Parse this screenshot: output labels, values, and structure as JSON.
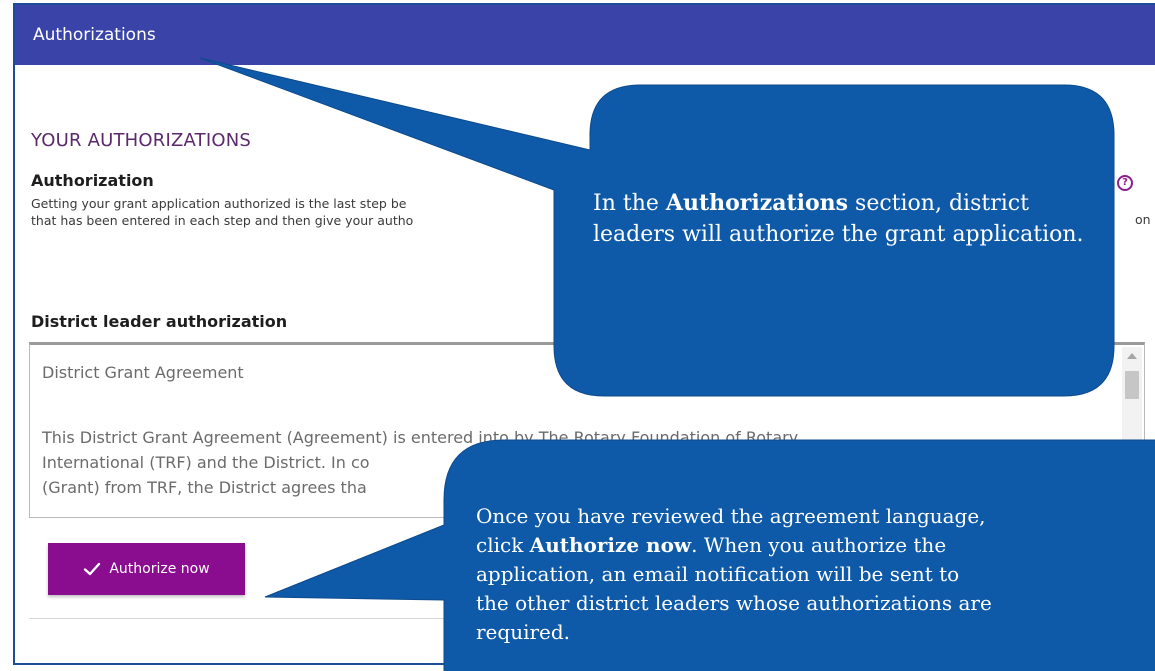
{
  "header": {
    "title": "Authorizations"
  },
  "section": {
    "title": "YOUR AUTHORIZATIONS",
    "auth_heading": "Authorization",
    "auth_desc_line1": "Getting your grant application authorized is the last step be",
    "auth_desc_line2": "that has been entered in each step and then give your autho",
    "auth_desc_tail": "on",
    "help_icon": "question-circle-icon"
  },
  "leader": {
    "heading": "District leader authorization"
  },
  "agreement": {
    "title": "District Grant Agreement",
    "body_line1": "This District Grant Agreement (Agreement) is entered into by The Rotary Foundation of Rotary",
    "body_line2": "International (TRF) and the District. In co",
    "body_line3": "(Grant) from TRF, the District agrees tha"
  },
  "actions": {
    "authorize_label": "Authorize now",
    "authorize_icon": "check-icon"
  },
  "callout1": {
    "pre": "In the ",
    "bold": "Authorizations",
    "post": " section, district leaders will authorize the grant application."
  },
  "callout2": {
    "line1": "Once you have reviewed the agreement language,",
    "line2_pre": "click ",
    "line2_bold": "Authorize now",
    "line2_post": ". When you authorize the",
    "line3": "application, an email notification will be sent to",
    "line4": "the other district leaders whose authorizations are",
    "line5": "required."
  },
  "colors": {
    "header_bg": "#3a44a8",
    "accent_purple": "#8a0d8f",
    "callout_blue": "#0f5aa8",
    "section_title": "#5b2a6c"
  }
}
